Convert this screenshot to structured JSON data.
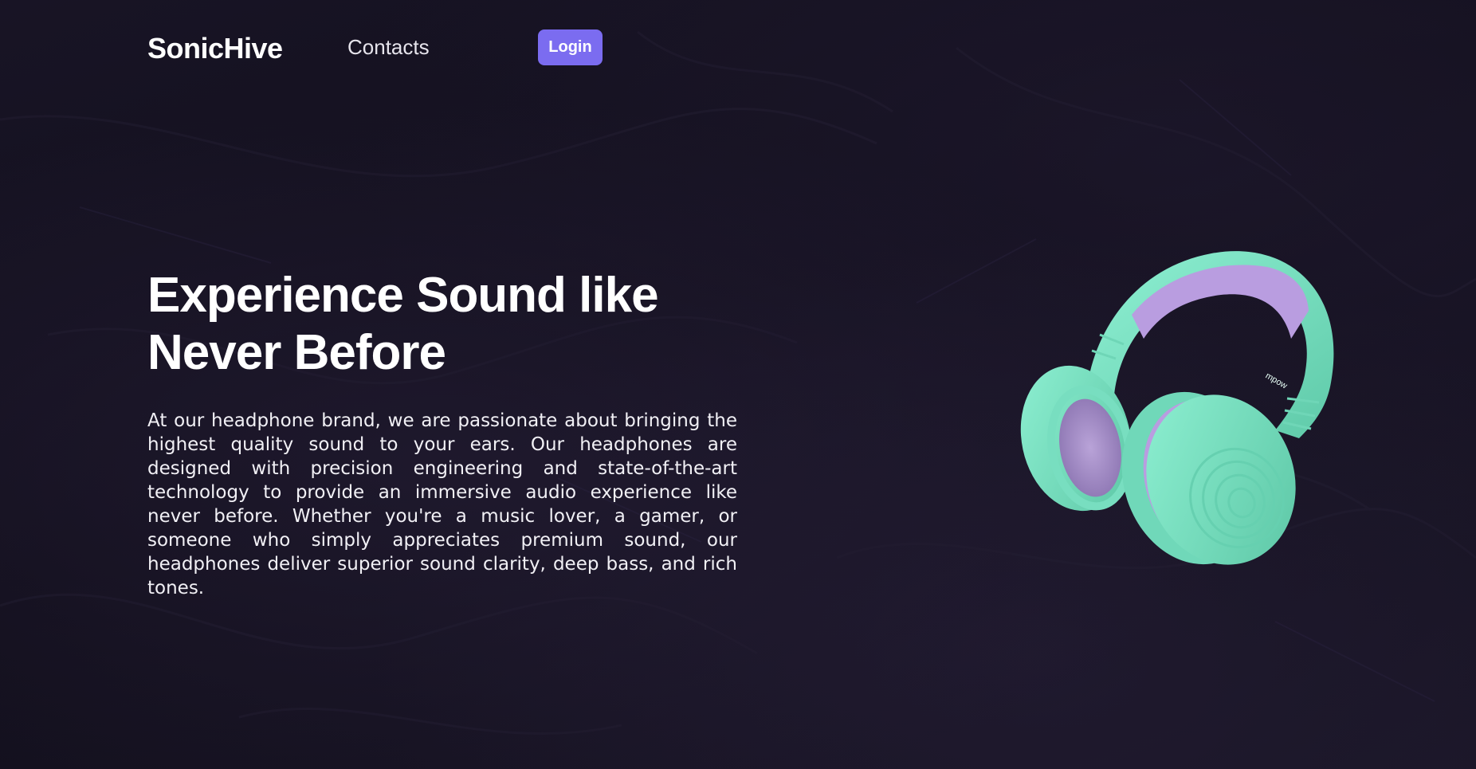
{
  "nav": {
    "brand": "SonicHive",
    "contacts_label": "Contacts",
    "login_label": "Login"
  },
  "hero": {
    "title_line1": "Experience Sound like",
    "title_line2": "Never Before",
    "description": "At our headphone brand, we are passionate about bringing the highest quality sound to your ears. Our headphones are designed with precision engineering and state-of-the-art technology to provide an immersive audio experience like never before. Whether you're a music lover, a gamer, or someone who simply appreciates premium sound, our headphones deliver superior sound clarity, deep bass, and rich tones."
  },
  "product_image": {
    "icon": "headphones-image",
    "brand_mark": "mpow"
  },
  "colors": {
    "background": "#15121f",
    "accent": "#7b6cf0",
    "headphone_body": "#7fe3c6",
    "headphone_padding": "#b89ae0"
  }
}
